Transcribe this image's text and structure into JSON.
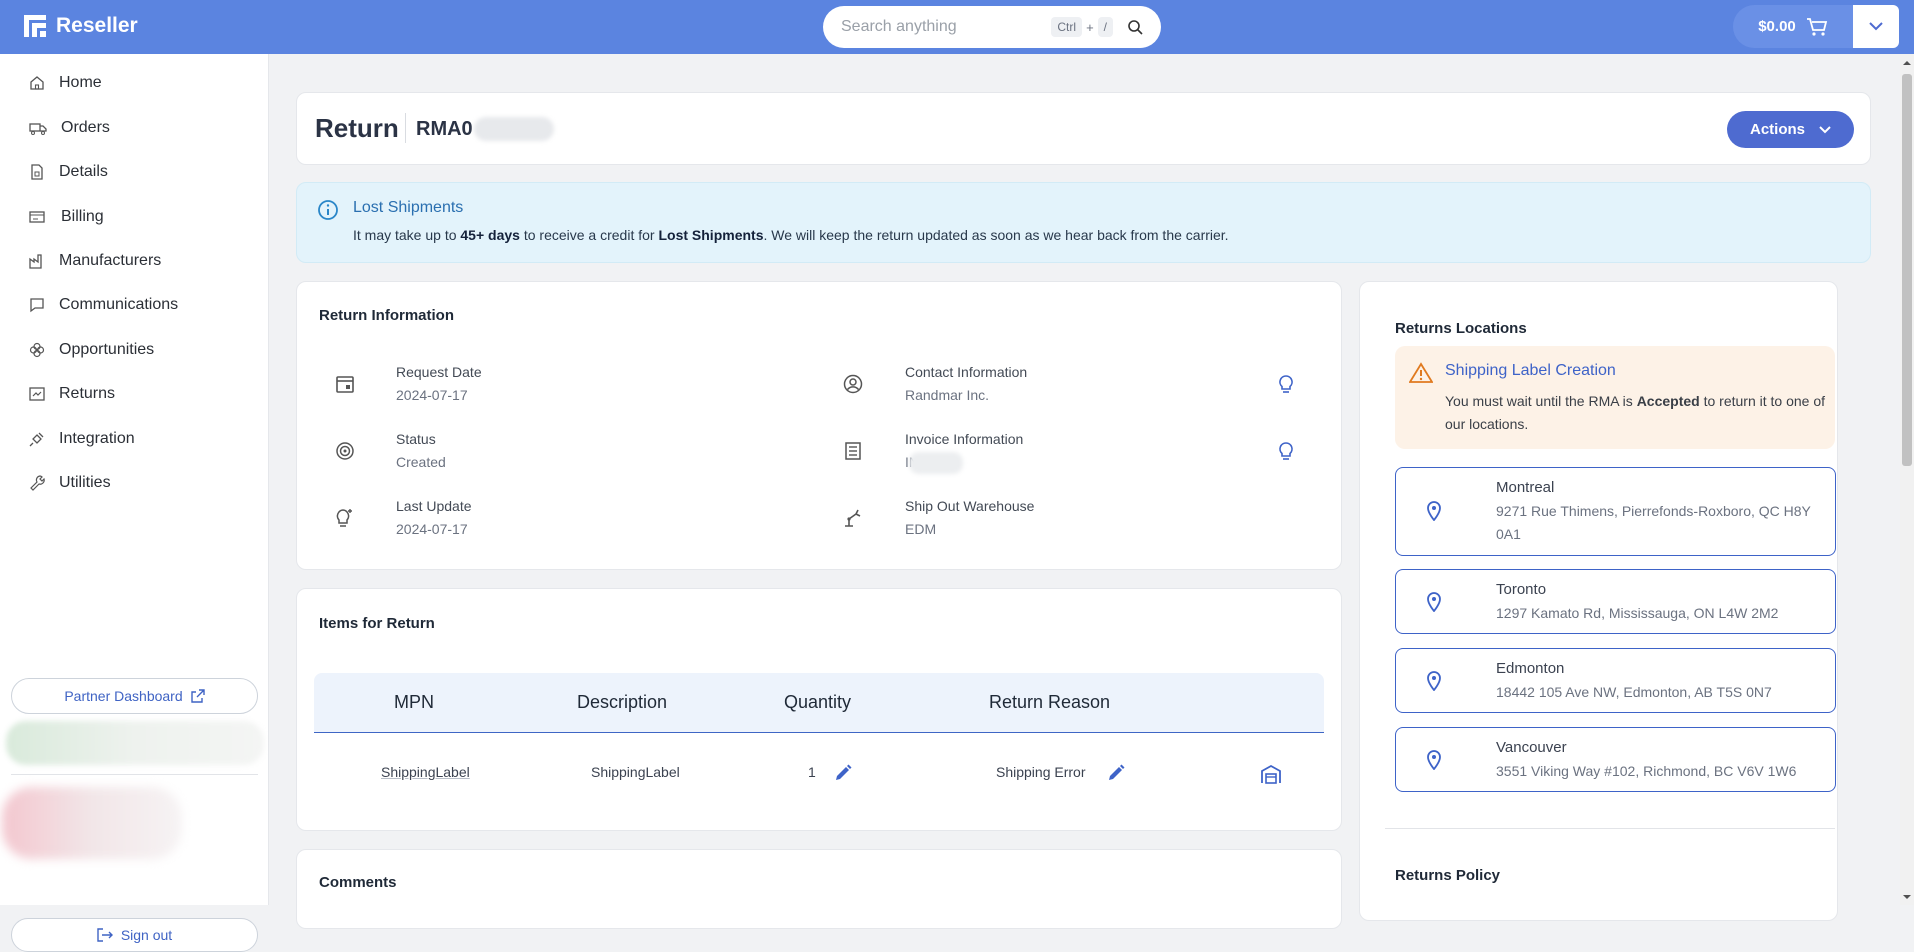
{
  "app": {
    "name": "Reseller"
  },
  "search": {
    "placeholder": "Search anything",
    "kbd_ctrl": "Ctrl",
    "kbd_plus": "+",
    "kbd_slash": "/"
  },
  "cart": {
    "total": "$0.00"
  },
  "sidebar": {
    "items": [
      {
        "label": "Home",
        "icon": "home-icon"
      },
      {
        "label": "Orders",
        "icon": "truck-icon"
      },
      {
        "label": "Details",
        "icon": "document-icon"
      },
      {
        "label": "Billing",
        "icon": "billing-icon"
      },
      {
        "label": "Manufacturers",
        "icon": "factory-icon"
      },
      {
        "label": "Communications",
        "icon": "chat-icon"
      },
      {
        "label": "Opportunities",
        "icon": "clover-icon"
      },
      {
        "label": "Returns",
        "icon": "returns-icon"
      },
      {
        "label": "Integration",
        "icon": "plug-icon"
      },
      {
        "label": "Utilities",
        "icon": "wrench-icon"
      }
    ],
    "partner_dashboard": "Partner Dashboard",
    "sign_out": "Sign out"
  },
  "page": {
    "title": "Return",
    "rma_prefix": "RMA0",
    "actions_label": "Actions"
  },
  "banner": {
    "title": "Lost Shipments",
    "text_1": "It may take up to ",
    "text_bold_1": "45+ days",
    "text_2": " to receive a credit for ",
    "text_bold_2": "Lost Shipments",
    "text_3": ". We will keep the return updated as soon as we hear back from the carrier."
  },
  "return_info": {
    "title": "Return Information",
    "request_date_label": "Request Date",
    "request_date": "2024-07-17",
    "status_label": "Status",
    "status": "Created",
    "last_update_label": "Last Update",
    "last_update": "2024-07-17",
    "contact_label": "Contact Information",
    "contact": "Randmar Inc.",
    "invoice_label": "Invoice Information",
    "invoice": "IN",
    "warehouse_label": "Ship Out Warehouse",
    "warehouse": "EDM"
  },
  "items": {
    "title": "Items for Return",
    "columns": [
      "MPN",
      "Description",
      "Quantity",
      "Return Reason"
    ],
    "rows": [
      {
        "mpn": "ShippingLabel",
        "description": "ShippingLabel",
        "quantity": "1",
        "reason": "Shipping Error"
      }
    ]
  },
  "comments": {
    "title": "Comments"
  },
  "returns_locations": {
    "title": "Returns Locations",
    "warning_title": "Shipping Label Creation",
    "warning_text_1": "You must wait until the RMA is ",
    "warning_bold": "Accepted",
    "warning_text_2": " to return it to one of our locations.",
    "locations": [
      {
        "city": "Montreal",
        "address": "9271 Rue Thimens, Pierrefonds-Roxboro, QC H8Y 0A1"
      },
      {
        "city": "Toronto",
        "address": "1297 Kamato Rd, Mississauga, ON L4W 2M2"
      },
      {
        "city": "Edmonton",
        "address": "18442 105 Ave NW, Edmonton, AB T5S 0N7"
      },
      {
        "city": "Vancouver",
        "address": "3551 Viking Way #102, Richmond, BC V6V 1W6"
      }
    ],
    "policy_title": "Returns Policy"
  },
  "colors": {
    "topbar": "#5b84e0",
    "accent": "#4e6bd0",
    "link": "#3e63c8",
    "info_bg": "#e3f3fb",
    "warn_bg": "#fdf2e7"
  }
}
